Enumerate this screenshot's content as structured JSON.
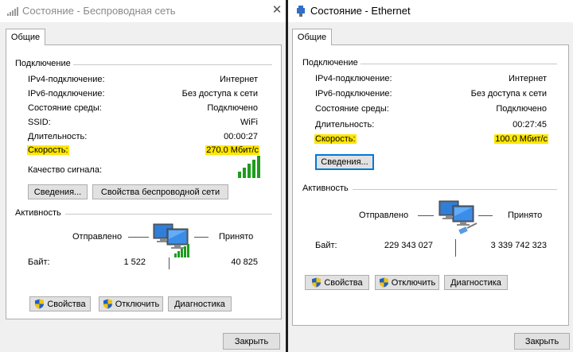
{
  "wireless": {
    "title": "Состояние - Беспроводная сеть",
    "tab": "Общие",
    "connection_heading": "Подключение",
    "rows": [
      {
        "label": "IPv4-подключение:",
        "value": "Интернет"
      },
      {
        "label": "IPv6-подключение:",
        "value": "Без доступа к сети"
      },
      {
        "label": "Состояние среды:",
        "value": "Подключено"
      },
      {
        "label": "SSID:",
        "value": "WiFi"
      },
      {
        "label": "Длительность:",
        "value": "00:00:27"
      },
      {
        "label": "Скорость:",
        "value": "270.0 Мбит/с"
      }
    ],
    "signal_label": "Качество сигнала:",
    "details_button": "Сведения...",
    "wireless_props_button": "Свойства беспроводной сети",
    "activity_heading": "Активность",
    "sent_label": "Отправлено",
    "received_label": "Принято",
    "bytes_label": "Байт:",
    "bytes_sent": "1 522",
    "bytes_received": "40 825",
    "properties_button": "Свойства",
    "disable_button": "Отключить",
    "diagnose_button": "Диагностика",
    "close_button": "Закрыть"
  },
  "ethernet": {
    "title": "Состояние - Ethernet",
    "tab": "Общие",
    "connection_heading": "Подключение",
    "rows": [
      {
        "label": "IPv4-подключение:",
        "value": "Интернет"
      },
      {
        "label": "IPv6-подключение:",
        "value": "Без доступа к сети"
      },
      {
        "label": "Состояние среды:",
        "value": "Подключено"
      },
      {
        "label": "Длительность:",
        "value": "00:27:45"
      },
      {
        "label": "Скорость:",
        "value": "100.0 Мбит/с"
      }
    ],
    "details_button": "Сведения...",
    "activity_heading": "Активность",
    "sent_label": "Отправлено",
    "received_label": "Принято",
    "bytes_label": "Байт:",
    "bytes_sent": "229 343 027",
    "bytes_received": "3 339 742 323",
    "properties_button": "Свойства",
    "disable_button": "Отключить",
    "diagnose_button": "Диагностика",
    "close_button": "Закрыть"
  },
  "colors": {
    "highlight": "#ffe600",
    "focus_border": "#0078d7",
    "signal_green": "#1e9c1e",
    "window_bg": "#f0f0f0"
  },
  "icons": {
    "wifi_titlebar": "wifi-signal-icon",
    "ethernet_titlebar": "ethernet-plug-icon",
    "network": "network-computers-icon",
    "shield": "uac-shield-icon",
    "close": "close-x-icon"
  }
}
